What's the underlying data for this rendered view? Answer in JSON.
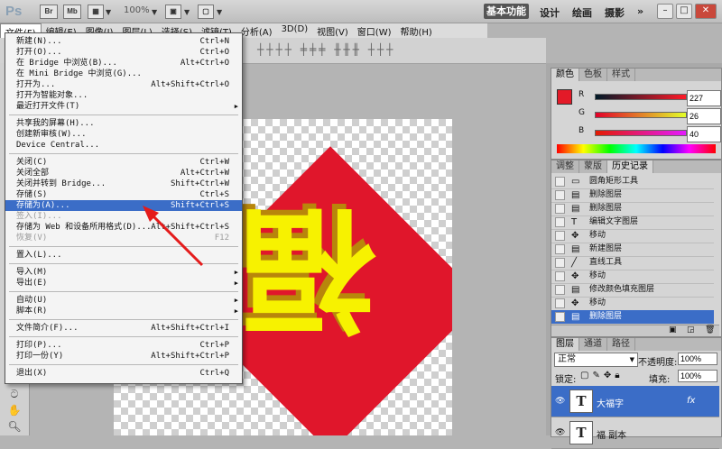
{
  "app": {
    "logo": "Ps",
    "toolbar_icons": [
      "Br",
      "Mb"
    ],
    "zoom": "100%",
    "workspaces": {
      "active": "基本功能",
      "others": [
        "设计",
        "绘画",
        "摄影"
      ],
      "more": "»"
    },
    "window_buttons": [
      "–",
      "□",
      "✕"
    ]
  },
  "menubar": [
    "文件(F)",
    "编辑(E)",
    "图像(I)",
    "图层(L)",
    "选择(S)",
    "滤镜(T)",
    "分析(A)",
    "3D(D)",
    "视图(V)",
    "窗口(W)",
    "帮助(H)"
  ],
  "file_menu": {
    "groups": [
      [
        {
          "label": "新建(N)...",
          "shortcut": "Ctrl+N"
        },
        {
          "label": "打开(O)...",
          "shortcut": "Ctrl+O"
        },
        {
          "label": "在 Bridge 中浏览(B)...",
          "shortcut": "Alt+Ctrl+O"
        },
        {
          "label": "在 Mini Bridge 中浏览(G)...",
          "shortcut": ""
        },
        {
          "label": "打开为...",
          "shortcut": "Alt+Shift+Ctrl+O"
        },
        {
          "label": "打开为智能对象...",
          "shortcut": ""
        },
        {
          "label": "最近打开文件(T)",
          "shortcut": "",
          "submenu": true
        }
      ],
      [
        {
          "label": "共享我的屏幕(H)...",
          "shortcut": ""
        },
        {
          "label": "创建新审核(W)...",
          "shortcut": ""
        },
        {
          "label": "Device Central...",
          "shortcut": ""
        }
      ],
      [
        {
          "label": "关闭(C)",
          "shortcut": "Ctrl+W"
        },
        {
          "label": "关闭全部",
          "shortcut": "Alt+Ctrl+W"
        },
        {
          "label": "关闭并转到 Bridge...",
          "shortcut": "Shift+Ctrl+W"
        },
        {
          "label": "存储(S)",
          "shortcut": "Ctrl+S"
        },
        {
          "label": "存储为(A)...",
          "shortcut": "Shift+Ctrl+S",
          "highlighted": true
        },
        {
          "label": "签入(I)...",
          "shortcut": "",
          "disabled": true
        },
        {
          "label": "存储为 Web 和设备所用格式(D)...",
          "shortcut": "Alt+Shift+Ctrl+S"
        },
        {
          "label": "恢复(V)",
          "shortcut": "F12",
          "disabled": true
        }
      ],
      [
        {
          "label": "置入(L)...",
          "shortcut": ""
        }
      ],
      [
        {
          "label": "导入(M)",
          "shortcut": "",
          "submenu": true
        },
        {
          "label": "导出(E)",
          "shortcut": "",
          "submenu": true
        }
      ],
      [
        {
          "label": "自动(U)",
          "shortcut": "",
          "submenu": true
        },
        {
          "label": "脚本(R)",
          "shortcut": "",
          "submenu": true
        }
      ],
      [
        {
          "label": "文件简介(F)...",
          "shortcut": "Alt+Shift+Ctrl+I"
        }
      ],
      [
        {
          "label": "打印(P)...",
          "shortcut": "Ctrl+P"
        },
        {
          "label": "打印一份(Y)",
          "shortcut": "Alt+Shift+Ctrl+P"
        }
      ],
      [
        {
          "label": "退出(X)",
          "shortcut": "Ctrl+Q"
        }
      ]
    ]
  },
  "color_panel": {
    "tabs": [
      "颜色",
      "色板",
      "样式"
    ],
    "channels": [
      {
        "label": "R",
        "value": "227"
      },
      {
        "label": "G",
        "value": "26"
      },
      {
        "label": "B",
        "value": "40"
      }
    ],
    "foreground": "#e31a28"
  },
  "history_panel": {
    "tabs": [
      "调整",
      "蒙版",
      "历史记录"
    ],
    "items": [
      {
        "icon": "▭",
        "label": "圆角矩形工具"
      },
      {
        "icon": "▤",
        "label": "删除图层"
      },
      {
        "icon": "▤",
        "label": "删除图层"
      },
      {
        "icon": "T",
        "label": "编辑文字图层"
      },
      {
        "icon": "✥",
        "label": "移动"
      },
      {
        "icon": "▤",
        "label": "新建图层"
      },
      {
        "icon": "╱",
        "label": "直线工具"
      },
      {
        "icon": "✥",
        "label": "移动"
      },
      {
        "icon": "▤",
        "label": "修改颜色填充图层"
      },
      {
        "icon": "✥",
        "label": "移动"
      },
      {
        "icon": "▤",
        "label": "删除图层",
        "selected": true
      }
    ]
  },
  "layers_panel": {
    "tabs": [
      "图层",
      "通道",
      "路径"
    ],
    "blend_mode": "正常",
    "opacity_label": "不透明度:",
    "opacity": "100%",
    "lock_label": "锁定:",
    "fill_label": "填充:",
    "fill": "100%",
    "layers": [
      {
        "thumb": "T",
        "name": "大福字",
        "selected": true,
        "fx": "fx"
      },
      {
        "thumb": "T",
        "name": "福 副本"
      }
    ]
  },
  "canvas": {
    "diamond_color": "#e0162b",
    "text_color": "#f7f200",
    "text": "福"
  }
}
